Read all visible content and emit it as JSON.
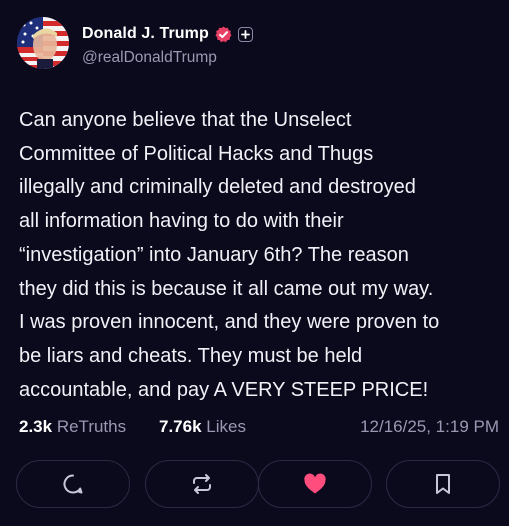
{
  "author": {
    "display_name": "Donald J. Trump",
    "handle": "@realDonaldTrump"
  },
  "post": {
    "text": "Can anyone believe that the Unselect\nCommittee of Political Hacks and Thugs\nillegally and criminally deleted and destroyed\nall information having to do with their\n“investigation” into January 6th? The reason\nthey did this is because it all came out my way.\nI was proven innocent, and they were proven to\nbe liars and cheats. They must be held\naccountable, and pay A VERY STEEP PRICE!"
  },
  "stats": {
    "retruths_count": "2.3k",
    "retruths_label": "ReTruths",
    "likes_count": "7.76k",
    "likes_label": "Likes",
    "timestamp": "12/16/25, 1:19 PM"
  },
  "actions": [
    {
      "icon": "reply-icon"
    },
    {
      "icon": "retruth-icon"
    },
    {
      "icon": "like-icon"
    },
    {
      "icon": "bookmark-icon"
    }
  ],
  "colors": {
    "background": "#0b0a1c",
    "verified": "#e83f66",
    "like": "#ff4d7d",
    "muted": "#9b98b3"
  }
}
